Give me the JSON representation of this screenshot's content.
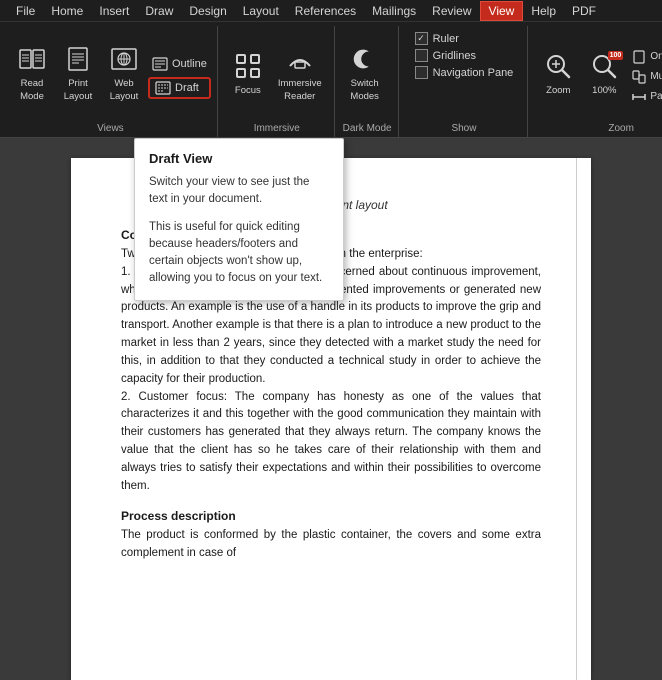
{
  "menubar": {
    "items": [
      "File",
      "Home",
      "Insert",
      "Draw",
      "Design",
      "Layout",
      "References",
      "Mailings",
      "Review",
      "View",
      "Help",
      "PDF"
    ]
  },
  "ribbon": {
    "groups": {
      "views": {
        "label": "Views",
        "buttons": {
          "read_mode": "Read\nMode",
          "print_layout": "Print\nLayout",
          "web_layout": "Web\nLayout",
          "outline": "Outline",
          "draft": "Draft"
        }
      },
      "immersive": {
        "label": "Immersive",
        "focus": "Focus",
        "immersive_reader": "Immersive\nReader"
      },
      "dark_mode": {
        "label": "Dark Mode",
        "switch_modes": "Switch\nModes"
      },
      "show": {
        "label": "Show",
        "ruler": "Ruler",
        "gridlines": "Gridlines",
        "navigation_pane": "Navigation Pane"
      },
      "zoom": {
        "label": "Zoom",
        "zoom": "Zoom",
        "zoom_percent": "100%",
        "one_page": "One\nPage",
        "multi": "Multi",
        "page_width": "Page\nWidth"
      }
    }
  },
  "tooltip": {
    "title": "Draft View",
    "paragraph1": "Switch your view to see just the text in your document.",
    "paragraph2": "This is useful for quick editing because headers/footers and certain objects won't show up, allowing you to focus on your text."
  },
  "document": {
    "figure_caption": "Figure 1. Plant layout",
    "sections": [
      {
        "title": "Competitive strategies",
        "content": "Two competitive strategies were identified in the enterprise:\n1. Product innovation: the company is concerned about continuous improvement, which is why they have constantly implemented improvements or generated new products. An example is the use of a handle in its products to improve the grip and transport. Another example is that there is a plan to introduce a new product to the market in less than 2 years, since they detected with a market study the need for this, in addition to that they conducted a technical study in order to achieve the capacity for their production.\n2. Customer focus: The company has honesty as one of the values that characterizes it and this together with the good communication they maintain with their customers has generated that they always return. The company knows the value that the client has so he takes care of their relationship with them and always tries to satisfy their expectations and within their possibilities to overcome them."
      },
      {
        "title": "Process description",
        "content": "The product is conformed by the plastic container, the covers and some extra complement in case of"
      }
    ]
  },
  "colors": {
    "accent_red": "#c42b1c",
    "ribbon_bg": "#1e1e1e",
    "text_light": "#d4d4d4",
    "tooltip_bg": "#ffffff"
  }
}
